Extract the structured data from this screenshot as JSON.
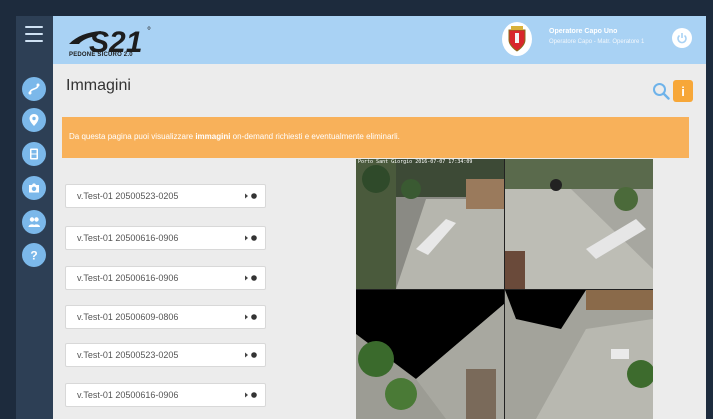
{
  "app": {
    "logo_text": "S21",
    "logo_degree": "°",
    "logo_subtitle": "PEDONE SICURO 2.0"
  },
  "user": {
    "name": "Operatore Capo Uno",
    "role": "Operatore Capo - Matr. Operatore 1"
  },
  "page": {
    "title": "Immagini"
  },
  "banner": {
    "prefix": "Da questa pagina puoi visualizzare ",
    "emphasis": "immagini",
    "suffix": " on-demand richiesti e eventualmente eliminarli."
  },
  "list": {
    "items": [
      {
        "label": "v.Test-01 20500523-0205"
      },
      {
        "label": "v.Test-01 20500616-0906"
      },
      {
        "label": "v.Test-01 20500616-0906"
      },
      {
        "label": "v.Test-01 20500609-0806"
      },
      {
        "label": "v.Test-01 20500523-0205"
      },
      {
        "label": "v.Test-01 20500616-0906"
      }
    ]
  },
  "video": {
    "timestamp": "Porto Sant Giorgio 2016-07-07 17:34:09"
  },
  "colors": {
    "header": "#a9d2f4",
    "sidebar": "#2d3f55",
    "accent": "#f8b15a",
    "side_icons": "#7bb8ea"
  },
  "icons": {
    "sidebar": [
      "route-icon",
      "location-pin-icon",
      "film-icon",
      "camera-icon",
      "users-icon",
      "help-icon"
    ]
  }
}
